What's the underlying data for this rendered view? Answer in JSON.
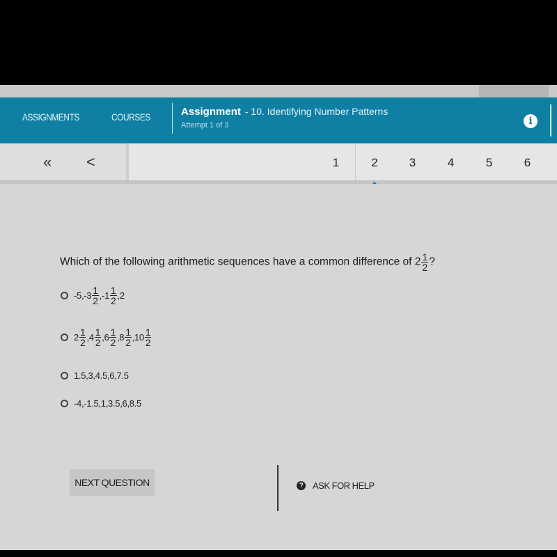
{
  "header": {
    "nav": [
      "ASSIGNMENTS",
      "COURSES"
    ],
    "title": "Assignment",
    "subtitle": "- 10. Identifying Number Patterns",
    "attempt": "Attempt 1 of 3",
    "info_icon": "i"
  },
  "pager": {
    "first": "«",
    "prev": "<",
    "pages": [
      "1",
      "2",
      "3",
      "4",
      "5",
      "6"
    ],
    "active_page": "2"
  },
  "question": {
    "text": "Which of the following arithmetic sequences have a common difference of",
    "whole": "2",
    "num": "1",
    "den": "2",
    "end": "?"
  },
  "options": [
    {
      "parts": [
        {
          "t": "-5,-3"
        },
        {
          "n": "1",
          "d": "2"
        },
        {
          "t": ",-1"
        },
        {
          "n": "1",
          "d": "2"
        },
        {
          "t": ",2"
        }
      ]
    },
    {
      "parts": [
        {
          "t": "2"
        },
        {
          "n": "1",
          "d": "2"
        },
        {
          "t": ",4"
        },
        {
          "n": "1",
          "d": "2"
        },
        {
          "t": ",6"
        },
        {
          "n": "1",
          "d": "2"
        },
        {
          "t": ",8"
        },
        {
          "n": "1",
          "d": "2"
        },
        {
          "t": ",10"
        },
        {
          "n": "1",
          "d": "2"
        }
      ]
    },
    {
      "parts": [
        {
          "t": "1.5,3,4.5,6,7.5"
        }
      ]
    },
    {
      "parts": [
        {
          "t": "-4,-1.5,1,3.5,6,8.5"
        }
      ]
    }
  ],
  "buttons": {
    "next": "NEXT QUESTION",
    "help": "ASK FOR HELP",
    "help_icon": "?"
  },
  "colors": {
    "header": "#0f7fa3"
  }
}
